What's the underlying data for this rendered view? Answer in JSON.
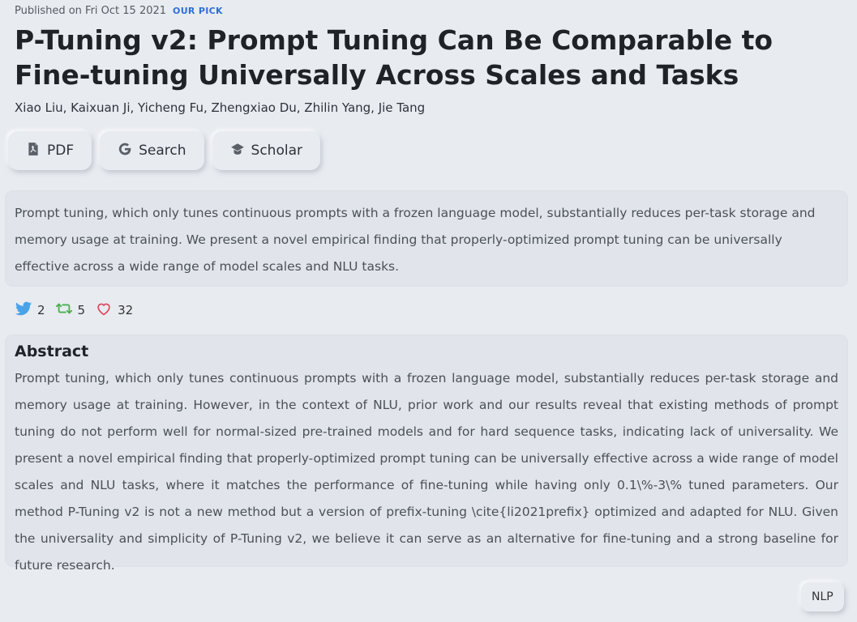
{
  "meta": {
    "published": "Published on Fri Oct 15 2021",
    "pick": "OUR PICK"
  },
  "paper": {
    "title": "P-Tuning v2: Prompt Tuning Can Be Comparable to Fine-tuning Universally Across Scales and Tasks",
    "authors": "Xiao Liu, Kaixuan Ji, Yicheng Fu, Zhengxiao Du, Zhilin Yang, Jie Tang"
  },
  "actions": {
    "pdf": "PDF",
    "search": "Search",
    "scholar": "Scholar"
  },
  "summary": "Prompt tuning, which only tunes continuous prompts with a frozen language model, substantially reduces per-task storage and memory usage at training. We present a novel empirical finding that properly-optimized prompt tuning can be universally effective across a wide range of model scales and NLU tasks.",
  "social": {
    "tweets": "2",
    "retweets": "5",
    "likes": "32"
  },
  "abstract": {
    "heading": "Abstract",
    "text": "Prompt tuning, which only tunes continuous prompts with a frozen language model, substantially reduces per-task storage and memory usage at training. However, in the context of NLU, prior work and our results reveal that existing methods of prompt tuning do not perform well for normal-sized pre-trained models and for hard sequence tasks, indicating lack of universality. We present a novel empirical finding that properly-optimized prompt tuning can be universally effective across a wide range of model scales and NLU tasks, where it matches the performance of fine-tuning while having only 0.1\\%-3\\% tuned parameters. Our method P-Tuning v2 is not a new method but a version of prefix-tuning \\cite{li2021prefix} optimized and adapted for NLU. Given the universality and simplicity of P-Tuning v2, we believe it can serve as an alternative for fine-tuning and a strong baseline for future research."
  },
  "tags": [
    "NLP"
  ],
  "icons": {
    "pdf": "file-pdf-icon",
    "search": "google-icon",
    "scholar": "scholar-icon",
    "tweet": "twitter-icon",
    "retweet": "retweet-icon",
    "like": "heart-icon"
  },
  "colors": {
    "accent": "#2f6fd6",
    "twitter": "#4aa3e8",
    "retweet": "#4caf50",
    "heart": "#e0455a"
  }
}
